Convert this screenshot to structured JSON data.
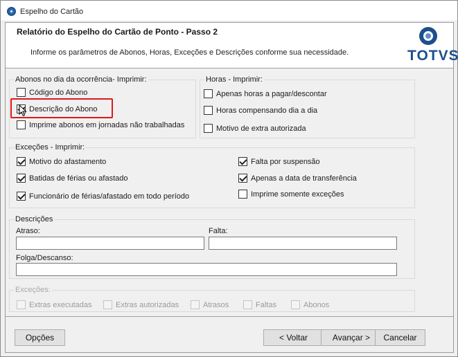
{
  "window": {
    "title": "Espelho do Cartão"
  },
  "header": {
    "title": "Relatório do Espelho do Cartão de Ponto - Passo 2",
    "subtitle": "Informe os parâmetros de Abonos, Horas, Exceções e Descrições conforme sua necessidade.",
    "logo_text": "TOTVS"
  },
  "abonos": {
    "legend": "Abonos no dia da ocorrência- Imprimir:",
    "items": [
      {
        "label": "Código do Abono",
        "checked": false
      },
      {
        "label": "Descrição do Abono",
        "checked": true
      },
      {
        "label": "Imprime abonos em jornadas não trabalhadas",
        "checked": false
      }
    ]
  },
  "horas": {
    "legend": "Horas - Imprimir:",
    "items": [
      {
        "label": "Apenas horas a pagar/descontar",
        "checked": false
      },
      {
        "label": "Horas compensando dia a dia",
        "checked": false
      },
      {
        "label": "Motivo de extra autorizada",
        "checked": false
      }
    ]
  },
  "excecoes_imprimir": {
    "legend": "Exceções - Imprimir:",
    "items": [
      {
        "label": "Motivo do afastamento",
        "checked": true
      },
      {
        "label": "Batidas de férias ou afastado",
        "checked": true
      },
      {
        "label": "Funcionário de férias/afastado em todo período",
        "checked": true
      },
      {
        "label": "Falta por suspensão",
        "checked": true
      },
      {
        "label": "Apenas a data de transferência",
        "checked": true
      },
      {
        "label": "Imprime somente exceções",
        "checked": false
      }
    ]
  },
  "descricoes": {
    "legend": "Descrições",
    "atraso_label": "Atraso:",
    "atraso_value": "",
    "falta_label": "Falta:",
    "falta_value": "",
    "folga_label": "Folga/Descanso:",
    "folga_value": ""
  },
  "excecoes_disabled": {
    "legend": "Exceções:",
    "items": [
      {
        "label": "Extras executadas",
        "checked": false
      },
      {
        "label": "Extras autorizadas",
        "checked": false
      },
      {
        "label": "Atrasos",
        "checked": false
      },
      {
        "label": "Faltas",
        "checked": false
      },
      {
        "label": "Abonos",
        "checked": false
      }
    ]
  },
  "footer": {
    "options_label": "Opções",
    "back_label": "< Voltar",
    "next_label": "Avançar >",
    "cancel_label": "Cancelar"
  },
  "colors": {
    "accent": "#1d4f8f",
    "highlight": "#e01818"
  }
}
